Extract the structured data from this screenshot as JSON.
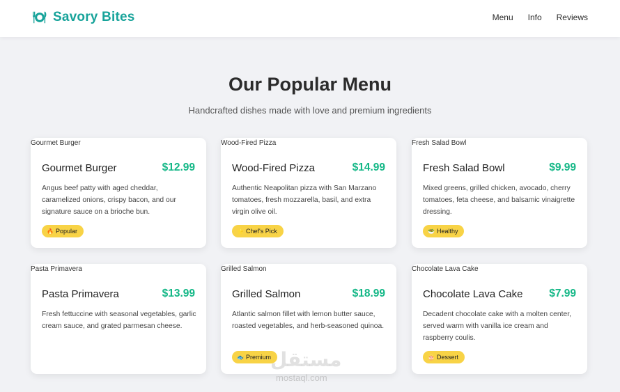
{
  "nav": {
    "brand": "Savory Bites",
    "links": [
      "Menu",
      "Info",
      "Reviews"
    ]
  },
  "hero": {
    "title": "Our Popular Menu",
    "subtitle": "Handcrafted dishes made with love and premium ingredients"
  },
  "menu": [
    {
      "img_alt": "Gourmet Burger",
      "name": "Gourmet Burger",
      "price": "$12.99",
      "description": "Angus beef patty with aged cheddar, caramelized onions, crispy bacon, and our signature sauce on a brioche bun.",
      "tag_emoji": "🔥",
      "tag": "Popular"
    },
    {
      "img_alt": "Wood-Fired Pizza",
      "name": "Wood-Fired Pizza",
      "price": "$14.99",
      "description": "Authentic Neapolitan pizza with San Marzano tomatoes, fresh mozzarella, basil, and extra virgin olive oil.",
      "tag_emoji": "⭐",
      "tag": "Chef's Pick"
    },
    {
      "img_alt": "Fresh Salad Bowl",
      "name": "Fresh Salad Bowl",
      "price": "$9.99",
      "description": "Mixed greens, grilled chicken, avocado, cherry tomatoes, feta cheese, and balsamic vinaigrette dressing.",
      "tag_emoji": "🥗",
      "tag": "Healthy"
    },
    {
      "img_alt": "Pasta Primavera",
      "name": "Pasta Primavera",
      "price": "$13.99",
      "description": "Fresh fettuccine with seasonal vegetables, garlic cream sauce, and grated parmesan cheese.",
      "tag_emoji": "",
      "tag": ""
    },
    {
      "img_alt": "Grilled Salmon",
      "name": "Grilled Salmon",
      "price": "$18.99",
      "description": "Atlantic salmon fillet with lemon butter sauce, roasted vegetables, and herb-seasoned quinoa.",
      "tag_emoji": "🐟",
      "tag": "Premium"
    },
    {
      "img_alt": "Chocolate Lava Cake",
      "name": "Chocolate Lava Cake",
      "price": "$7.99",
      "description": "Decadent chocolate cake with a molten center, served warm with vanilla ice cream and raspberry coulis.",
      "tag_emoji": "🎂",
      "tag": "Dessert"
    }
  ],
  "watermark": {
    "main": "مستقل",
    "sub": "mostaql.com"
  },
  "colors": {
    "brand": "#17a39a",
    "price": "#13b786",
    "tag_bg": "#f8d346",
    "page_bg": "#f1f2f5"
  },
  "icons": {
    "brand": "plate-utensils-icon"
  }
}
